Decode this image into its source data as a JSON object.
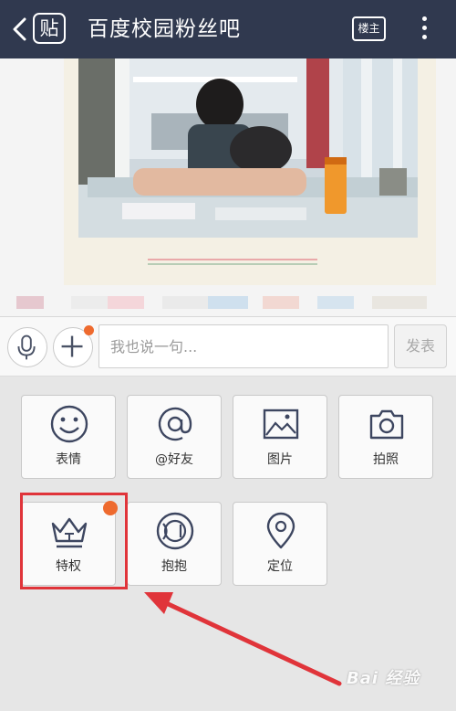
{
  "header": {
    "logo_text": "贴",
    "title": "百度校园粉丝吧",
    "louzhu_label": "楼主",
    "back_icon": "chevron-left-icon",
    "more_icon": "vertical-dots-icon"
  },
  "input_bar": {
    "placeholder": "我也说一句...",
    "send_label": "发表",
    "mic_icon": "microphone-icon",
    "plus_icon": "plus-icon"
  },
  "panel": {
    "tiles": [
      {
        "label": "表情",
        "icon": "smiley-icon"
      },
      {
        "label": "@好友",
        "icon": "at-sign-icon"
      },
      {
        "label": "图片",
        "icon": "picture-icon"
      },
      {
        "label": "拍照",
        "icon": "camera-icon"
      },
      {
        "label": "特权",
        "icon": "crown-icon"
      },
      {
        "label": "抱抱",
        "icon": "hug-circle-icon"
      },
      {
        "label": "定位",
        "icon": "location-pin-icon"
      }
    ]
  },
  "annotation": {
    "highlight_color": "#e0343a",
    "badge_color": "#ee6a2e"
  },
  "watermark": {
    "text": "Bai 经验"
  },
  "colors": {
    "topbar": "#30394f",
    "icon_stroke": "#3d4660"
  }
}
